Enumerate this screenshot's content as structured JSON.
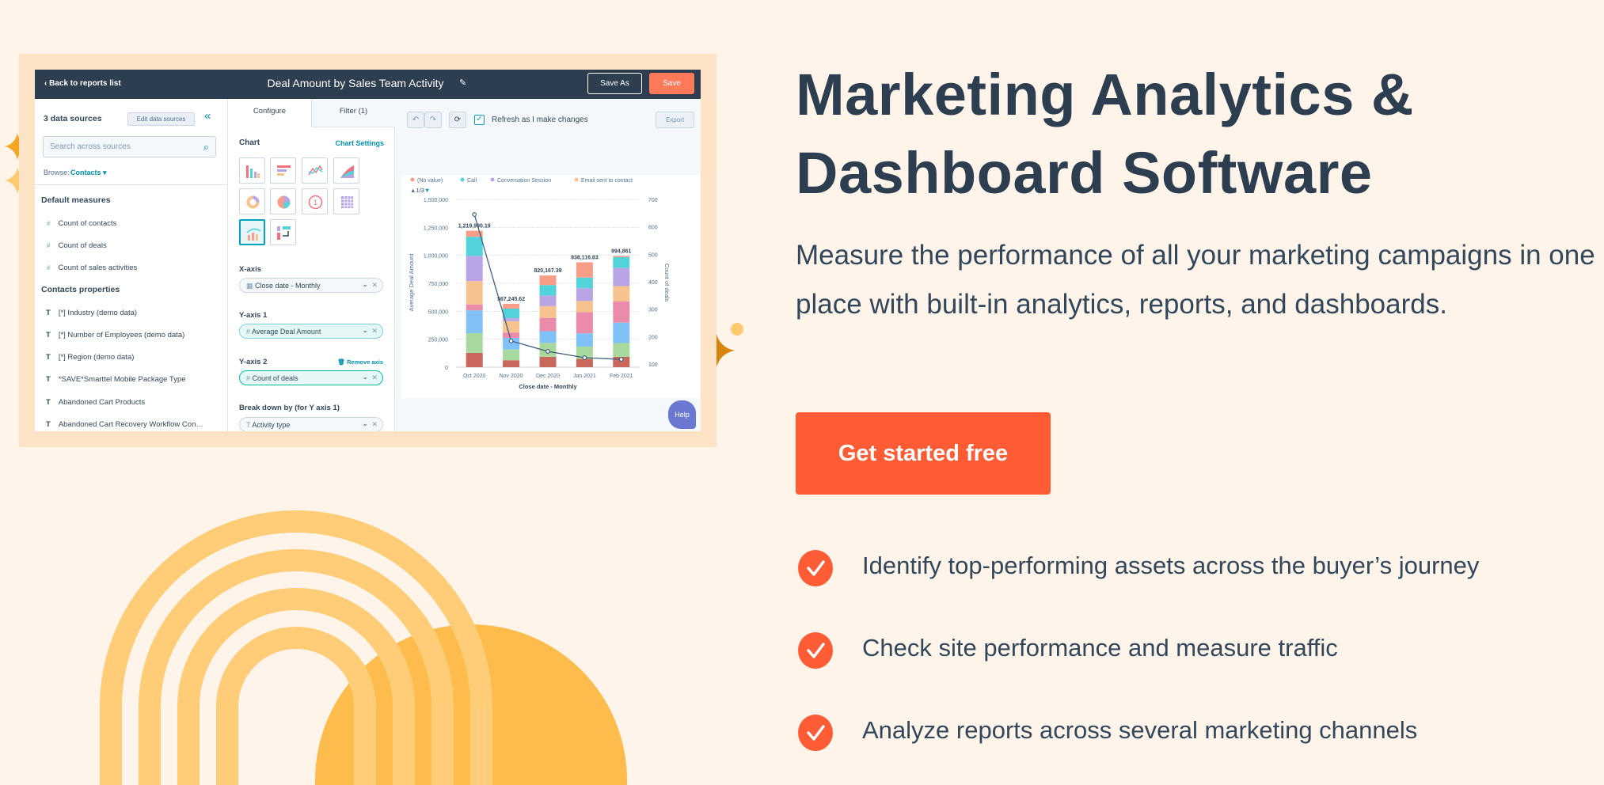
{
  "colors": {
    "background": "#FEF4EA",
    "accent": "#FF5C35",
    "heading": "#2D3E50",
    "arc": "#FFCD78",
    "sun": "#FEBC4C"
  },
  "hero": {
    "title_line1": "Marketing Analytics &",
    "title_line2": "Dashboard Software",
    "description": "Measure the performance of all your marketing campaigns in one place with built-in analytics, reports, and dashboards.",
    "cta_label": "Get started free",
    "features": [
      {
        "icon": "check-circle-icon",
        "text": "Identify top-performing assets across the buyer’s journey"
      },
      {
        "icon": "check-circle-icon",
        "text": "Check site performance and measure traffic"
      },
      {
        "icon": "check-circle-icon",
        "text": "Analyze reports across several marketing channels"
      }
    ]
  },
  "app": {
    "header": {
      "back_label": "Back to reports list",
      "report_title": "Deal Amount by Sales Team Activity",
      "save_as_label": "Save As",
      "save_label": "Save"
    },
    "sources": {
      "count_label": "3 data sources",
      "edit_label": "Edit data sources",
      "search_placeholder": "Search across sources",
      "browse_label": "Browse:",
      "browse_value": "Contacts",
      "default_measures_title": "Default measures",
      "default_measures": [
        "Count of contacts",
        "Count of deals",
        "Count of sales activities"
      ],
      "properties_title": "Contacts properties",
      "properties": [
        "[*] Industry (demo data)",
        "[*] Number of Employees (demo data)",
        "[*] Region (demo data)",
        "*SAVE*Smarttel Mobile Package Type",
        "Abandoned Cart Products",
        "Abandoned Cart Recovery Workflow Con…"
      ]
    },
    "config": {
      "tabs": [
        {
          "label": "Configure",
          "active": true
        },
        {
          "label": "Filter (1)",
          "active": false
        }
      ],
      "chart_label": "Chart",
      "chart_settings_label": "Chart Settings",
      "chart_types": [
        "vertical-bar",
        "horizontal-bar",
        "line",
        "area",
        "donut",
        "pie",
        "summary",
        "pivot",
        "combination",
        "sankey"
      ],
      "selected_chart_type": "combination",
      "x_axis_label": "X-axis",
      "x_axis_value": "Close date - Monthly",
      "y_axis1_label": "Y-axis 1",
      "y_axis1_value": "Average Deal Amount",
      "y_axis2_label": "Y-axis 2",
      "remove_axis_label": "Remove axis",
      "y_axis2_value": "Count of deals",
      "breakdown_label": "Break down by (for Y axis 1)",
      "breakdown_value": "Activity type"
    },
    "toolbar": {
      "refresh_label": "Refresh as I make changes",
      "refresh_checked": true,
      "export_label": "Export"
    },
    "help_label": "Help"
  },
  "chart_data": {
    "type": "bar",
    "stacked": true,
    "categories": [
      "Oct 2020",
      "Nov 2020",
      "Dec 2020",
      "Jan 2021",
      "Feb 2021"
    ],
    "xlabel": "Close date - Monthly",
    "ylabel": "Average Deal Amount",
    "y2label": "Count of deals",
    "ylim": [
      0,
      1500000
    ],
    "yticks": [
      "0",
      "250,000",
      "500,000",
      "750,000",
      "1,000,000",
      "1,250,000",
      "1,500,000"
    ],
    "y2lim": [
      100,
      700
    ],
    "y2ticks": [
      "100",
      "200",
      "300",
      "400",
      "500",
      "600",
      "700"
    ],
    "legend_page": "1/3",
    "legend_position": "top",
    "grid": true,
    "series": [
      {
        "color": "#C9685A",
        "values": [
          128000,
          62000,
          93000,
          74000,
          92000
        ]
      },
      {
        "color": "#A6D99B",
        "values": [
          176000,
          96000,
          124000,
          110000,
          124000
        ]
      },
      {
        "color": "#80C1F7",
        "values": [
          204000,
          104000,
          105000,
          119000,
          183000
        ]
      },
      {
        "color": "#EB8BAA",
        "values": [
          53000,
          48000,
          119000,
          189000,
          190000
        ]
      },
      {
        "name": "Email sent to contact",
        "color": "#F6C38F",
        "values": [
          209000,
          101000,
          105000,
          100000,
          136000
        ]
      },
      {
        "name": "Conversation Session",
        "color": "#B9A5E6",
        "values": [
          225000,
          27000,
          95000,
          114000,
          162000
        ]
      },
      {
        "name": "Call",
        "color": "#51D3D9",
        "values": [
          171000,
          86000,
          93000,
          95000,
          97000
        ]
      },
      {
        "name": "(No value)",
        "color": "#F89E88",
        "values": [
          54000,
          43000,
          86000,
          137000,
          11000
        ]
      }
    ],
    "totals": [
      "1,219,990.19",
      "567,245.62",
      "820,167.39",
      "938,116.83",
      "994,861"
    ],
    "line": {
      "name": "Count of deals",
      "axis": "right",
      "color": "#43607E",
      "values": [
        645,
        184,
        146,
        123,
        117
      ]
    }
  }
}
